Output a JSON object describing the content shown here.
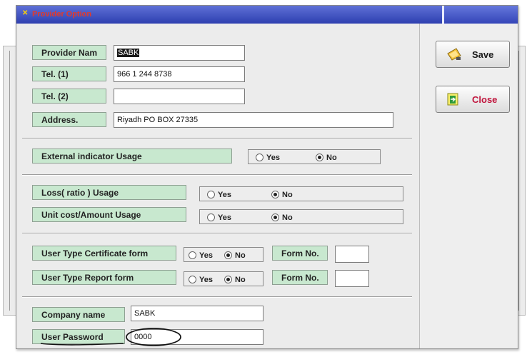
{
  "window": {
    "title": "Provider Option"
  },
  "provider": {
    "name_label": "Provider Nam",
    "name_value": "SABK",
    "tel1_label": "Tel. (1)",
    "tel1_value": "966 1 244 8738",
    "tel2_label": "Tel. (2)",
    "tel2_value": "",
    "address_label": "Address.",
    "address_value": "Riyadh PO BOX 27335"
  },
  "usage": {
    "external_label": "External indicator Usage",
    "loss_label": "Loss( ratio )  Usage",
    "unit_label": "Unit cost/Amount Usage",
    "yes": "Yes",
    "no": "No",
    "selected": "No"
  },
  "user_type": {
    "certificate_label": "User Type Certificate form",
    "report_label": "User Type Report form",
    "form_no_label": "Form No.",
    "certificate_form_no": "",
    "report_form_no": "",
    "yes": "Yes",
    "no": "No",
    "selected": "No"
  },
  "company": {
    "name_label": "Company name",
    "name_value": "SABK",
    "password_label": "User Password",
    "password_value": "0000"
  },
  "buttons": {
    "save": "Save",
    "close": "Close"
  },
  "colors": {
    "label_bg": "#c8e8cf",
    "titlebar": "#2e3fb0",
    "title_text": "#e23a2a",
    "close_text": "#c0143c"
  }
}
